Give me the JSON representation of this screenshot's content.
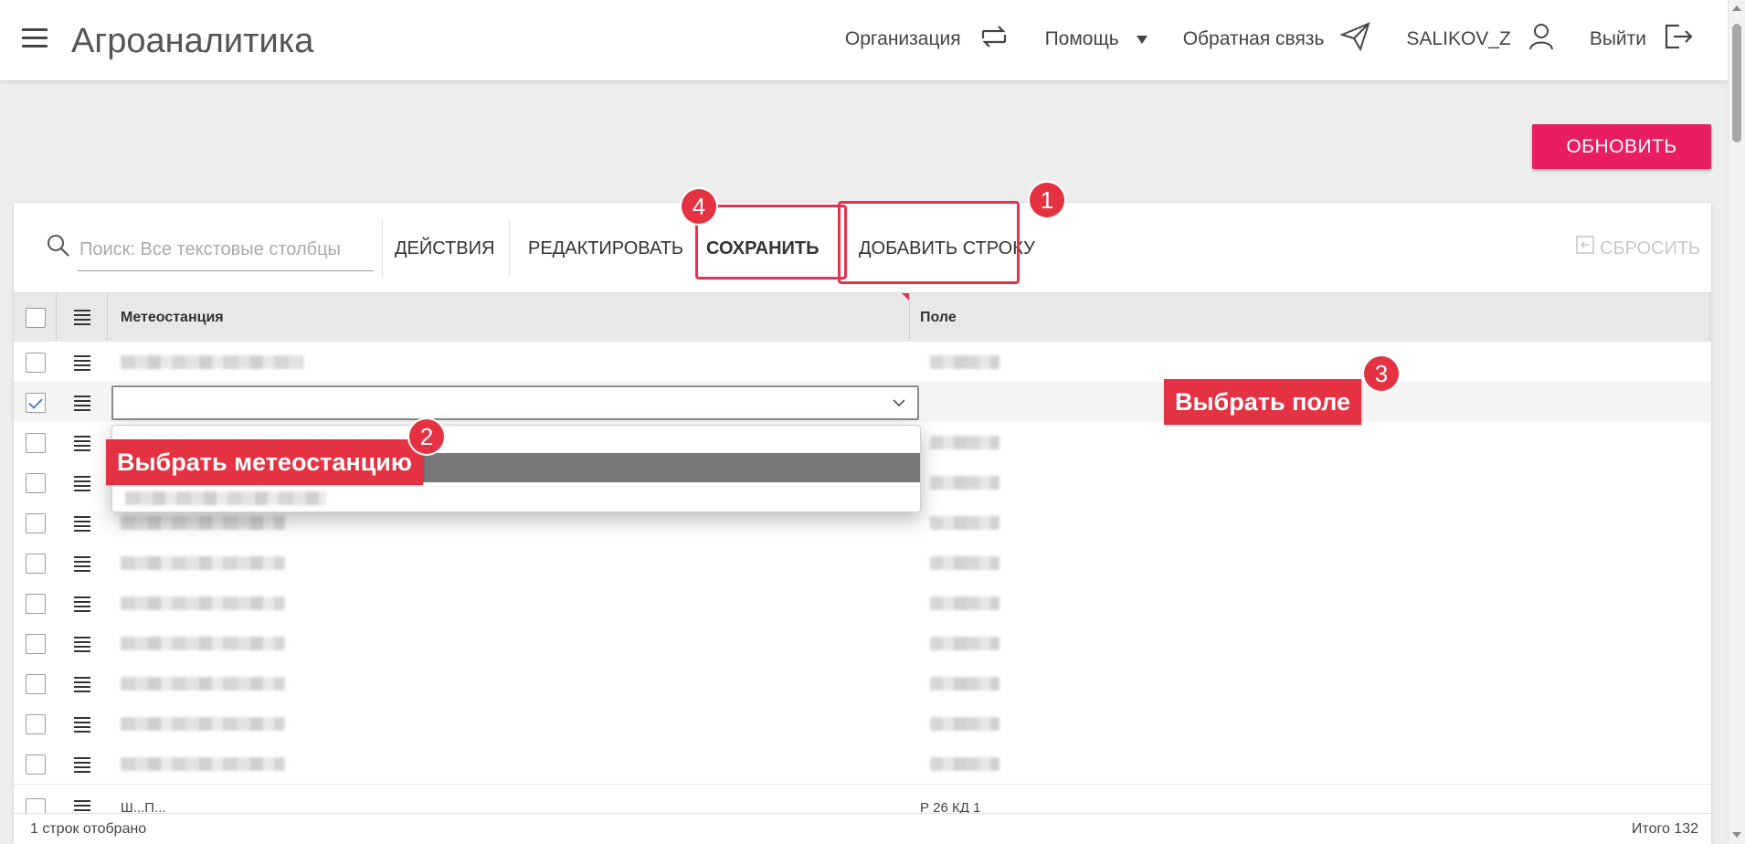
{
  "app": {
    "title": "Агроаналитика"
  },
  "nav": {
    "organization": "Организация",
    "help": "Помощь",
    "feedback": "Обратная связь",
    "user": "SALIKOV_Z",
    "logout": "Выйти"
  },
  "refresh_button": "ОБНОВИТЬ",
  "toolbar": {
    "search_placeholder": "Поиск: Все текстовые столбцы",
    "actions": "ДЕЙСТВИЯ",
    "edit": "РЕДАКТИРОВАТЬ",
    "save": "СОХРАНИТЬ",
    "add_row": "ДОБАВИТЬ СТРОКУ",
    "reset": "СБРОСИТЬ"
  },
  "grid": {
    "columns": [
      "Метеостанция",
      "Поле"
    ],
    "rows": [
      {
        "selected": false,
        "station": "",
        "field": ""
      },
      {
        "selected": true,
        "station": "",
        "field": ""
      },
      {
        "selected": false,
        "station": "",
        "field": ""
      },
      {
        "selected": false,
        "station": "",
        "field": ""
      },
      {
        "selected": false,
        "station": "",
        "field": ""
      },
      {
        "selected": false,
        "station": "",
        "field": ""
      },
      {
        "selected": false,
        "station": "",
        "field": ""
      },
      {
        "selected": false,
        "station": "",
        "field": ""
      },
      {
        "selected": false,
        "station": "",
        "field": ""
      },
      {
        "selected": false,
        "station": "",
        "field": ""
      },
      {
        "selected": false,
        "station": "",
        "field": ""
      }
    ],
    "partial_row_station": "Ш...П...",
    "partial_row_field": "Р 26 КД 1"
  },
  "footer": {
    "selected_count": "1 строк отобрано",
    "total": "Итого 132"
  },
  "annotations": {
    "badge_1": "1",
    "badge_2": "2",
    "badge_3": "3",
    "badge_4": "4",
    "callout_station": "Выбрать метеостанцию",
    "callout_field": "Выбрать поле"
  },
  "colors": {
    "accent": "#e81d62",
    "annotation": "#e53242",
    "header_bg": "#ffffff",
    "page_bg": "#ededed"
  }
}
